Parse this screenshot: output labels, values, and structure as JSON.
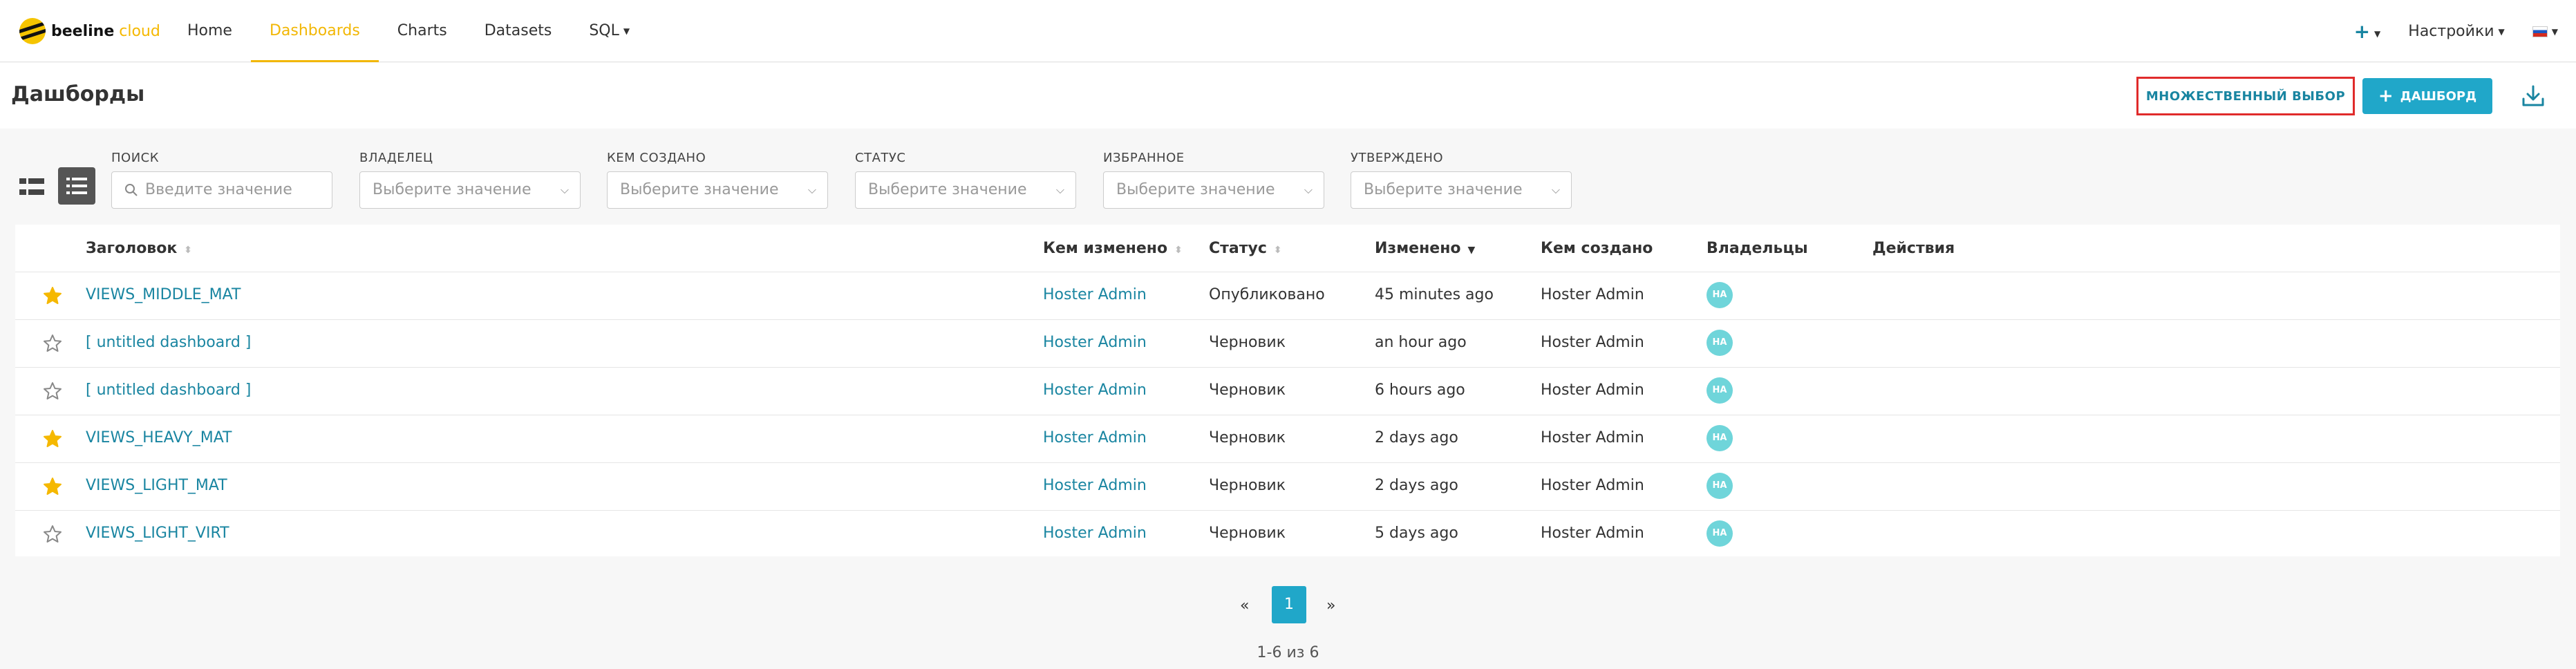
{
  "brand": {
    "name": "beeline",
    "suffix": " cloud"
  },
  "nav": [
    {
      "label": "Home",
      "active": false
    },
    {
      "label": "Dashboards",
      "active": true
    },
    {
      "label": "Charts",
      "active": false
    },
    {
      "label": "Datasets",
      "active": false
    },
    {
      "label": "SQL",
      "active": false
    }
  ],
  "top_right": {
    "plus_icon": "plus-icon",
    "settings_label": "Настройки",
    "language": "ru"
  },
  "header": {
    "title": "Дашборды",
    "bulk_select_label": "МНОЖЕСТВЕННЫЙ ВЫБОР",
    "new_dashboard_label": "ДАШБОРД",
    "download_icon": "download-icon"
  },
  "filters": {
    "search": {
      "label": "ПОИСК",
      "placeholder": "Введите значение"
    },
    "owner": {
      "label": "ВЛАДЕЛЕЦ",
      "placeholder": "Выберите значение"
    },
    "created_by": {
      "label": "КЕМ СОЗДАНО",
      "placeholder": "Выберите значение"
    },
    "status": {
      "label": "СТАТУС",
      "placeholder": "Выберите значение"
    },
    "favorite": {
      "label": "ИЗБРАННОЕ",
      "placeholder": "Выберите значение"
    },
    "certified": {
      "label": "УТВЕРЖДЕНО",
      "placeholder": "Выберите значение"
    }
  },
  "table": {
    "columns": [
      "Заголовок",
      "Кем изменено",
      "Статус",
      "Изменено",
      "Кем создано",
      "Владельцы",
      "Действия"
    ],
    "rows": [
      {
        "favorite": true,
        "title": "VIEWS_MIDDLE_MAT",
        "modified_by": "Hoster Admin",
        "status": "Опубликовано",
        "modified": "45 minutes ago",
        "created_by": "Hoster Admin",
        "owner_initials": "HA"
      },
      {
        "favorite": false,
        "title": "[ untitled dashboard ]",
        "modified_by": "Hoster Admin",
        "status": "Черновик",
        "modified": "an hour ago",
        "created_by": "Hoster Admin",
        "owner_initials": "HA"
      },
      {
        "favorite": false,
        "title": "[ untitled dashboard ]",
        "modified_by": "Hoster Admin",
        "status": "Черновик",
        "modified": "6 hours ago",
        "created_by": "Hoster Admin",
        "owner_initials": "HA"
      },
      {
        "favorite": true,
        "title": "VIEWS_HEAVY_MAT",
        "modified_by": "Hoster Admin",
        "status": "Черновик",
        "modified": "2 days ago",
        "created_by": "Hoster Admin",
        "owner_initials": "HA"
      },
      {
        "favorite": true,
        "title": "VIEWS_LIGHT_MAT",
        "modified_by": "Hoster Admin",
        "status": "Черновик",
        "modified": "2 days ago",
        "created_by": "Hoster Admin",
        "owner_initials": "HA"
      },
      {
        "favorite": false,
        "title": "VIEWS_LIGHT_VIRT",
        "modified_by": "Hoster Admin",
        "status": "Черновик",
        "modified": "5 days ago",
        "created_by": "Hoster Admin",
        "owner_initials": "HA"
      }
    ]
  },
  "pagination": {
    "prev": "«",
    "current": "1",
    "next": "»",
    "summary": "1-6 из 6"
  },
  "colors": {
    "accent": "#f2b705",
    "link": "#1985a1",
    "primary": "#20a7c9",
    "star": "#f5b800",
    "avatar": "#6fd5da",
    "highlight": "#e02b2b"
  }
}
